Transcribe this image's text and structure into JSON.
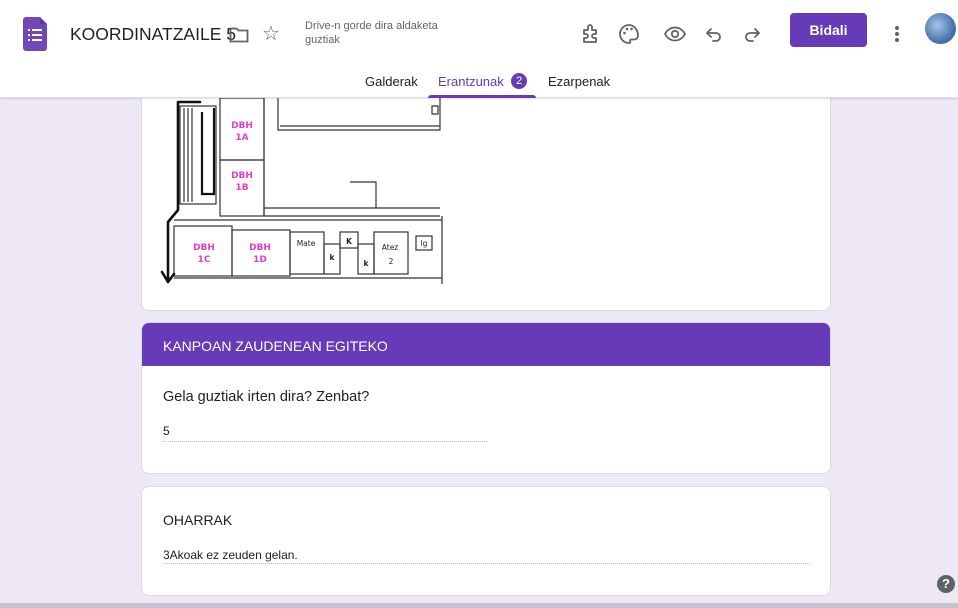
{
  "header": {
    "title": "KOORDINATZAILE 5",
    "save_status": "Drive-n gorde dira aldaketa guztiak",
    "send_label": "Bidali"
  },
  "tabs": [
    {
      "label": "Galderak"
    },
    {
      "label": "Erantzunak",
      "badge": "2",
      "active": true
    },
    {
      "label": "Ezarpenak"
    }
  ],
  "floorplan": {
    "rooms": [
      {
        "label1": "DBH",
        "label2": "1A"
      },
      {
        "label1": "DBH",
        "label2": "1B"
      },
      {
        "label1": "DBH",
        "label2": "1C"
      },
      {
        "label1": "DBH",
        "label2": "1D"
      }
    ],
    "labels": [
      "Mate",
      "K",
      "k",
      "k",
      "Atez",
      "2",
      "lg"
    ]
  },
  "section": {
    "title": "KANPOAN ZAUDENEAN EGITEKO",
    "question": "Gela guztiak irten dira? Zenbat?",
    "answer": "5"
  },
  "notes": {
    "title": "OHARRAK",
    "answer": "3Akoak ez zeuden gelan."
  },
  "colors": {
    "accent": "#673ab7",
    "background": "#ede7f6",
    "room_label": "#e040c8"
  },
  "icons": [
    "forms-app-icon",
    "folder-icon",
    "star-icon",
    "addon-icon",
    "palette-icon",
    "eye-icon",
    "undo-icon",
    "redo-icon",
    "more-vert-icon",
    "help-icon"
  ]
}
